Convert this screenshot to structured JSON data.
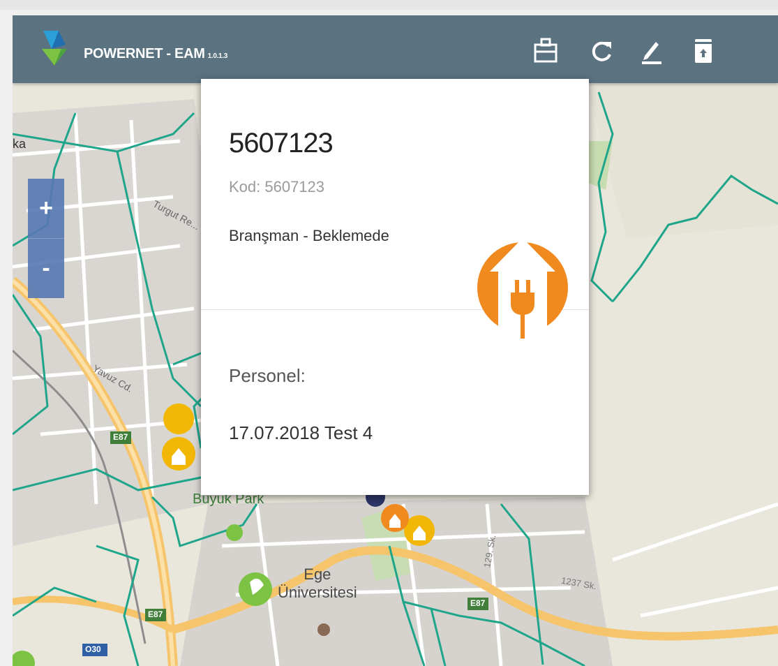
{
  "app": {
    "name": "POWERNET - EAM",
    "version": "1.0.1.3",
    "logo_icon": "powernet-logo-icon"
  },
  "toolbar": {
    "buttons": [
      {
        "name": "briefcase-icon"
      },
      {
        "name": "refresh-icon"
      },
      {
        "name": "pencil-icon"
      },
      {
        "name": "save-icon"
      }
    ]
  },
  "zoom": {
    "in_label": "+",
    "out_label": "-"
  },
  "popup": {
    "title": "5607123",
    "code": "Kod: 5607123",
    "status": "Branşman - Beklemede",
    "personnel_label": "Personel:",
    "personnel_value": "17.07.2018 Test 4",
    "icon": "house-plug-icon",
    "icon_color": "#f08a1e"
  },
  "map": {
    "labels": {
      "edge": "ka",
      "street1": "Turgut Re...",
      "street2": "Yavuz Cd.",
      "park": "Büyük Park",
      "university": "Ege\nÜniversitesi",
      "street3": "129. Sk.",
      "street4": "1237 Sk.",
      "road1": "E87",
      "road2": "E87",
      "road3": "E87",
      "road4": "O30"
    },
    "colors": {
      "background": "#e8e4d8",
      "roads": "#ffffff",
      "highway": "#f5c46b",
      "lines": "#1ea58a",
      "marker_yellow": "#f2b705",
      "marker_green": "#7cc243",
      "marker_orange": "#f08a1e"
    }
  }
}
